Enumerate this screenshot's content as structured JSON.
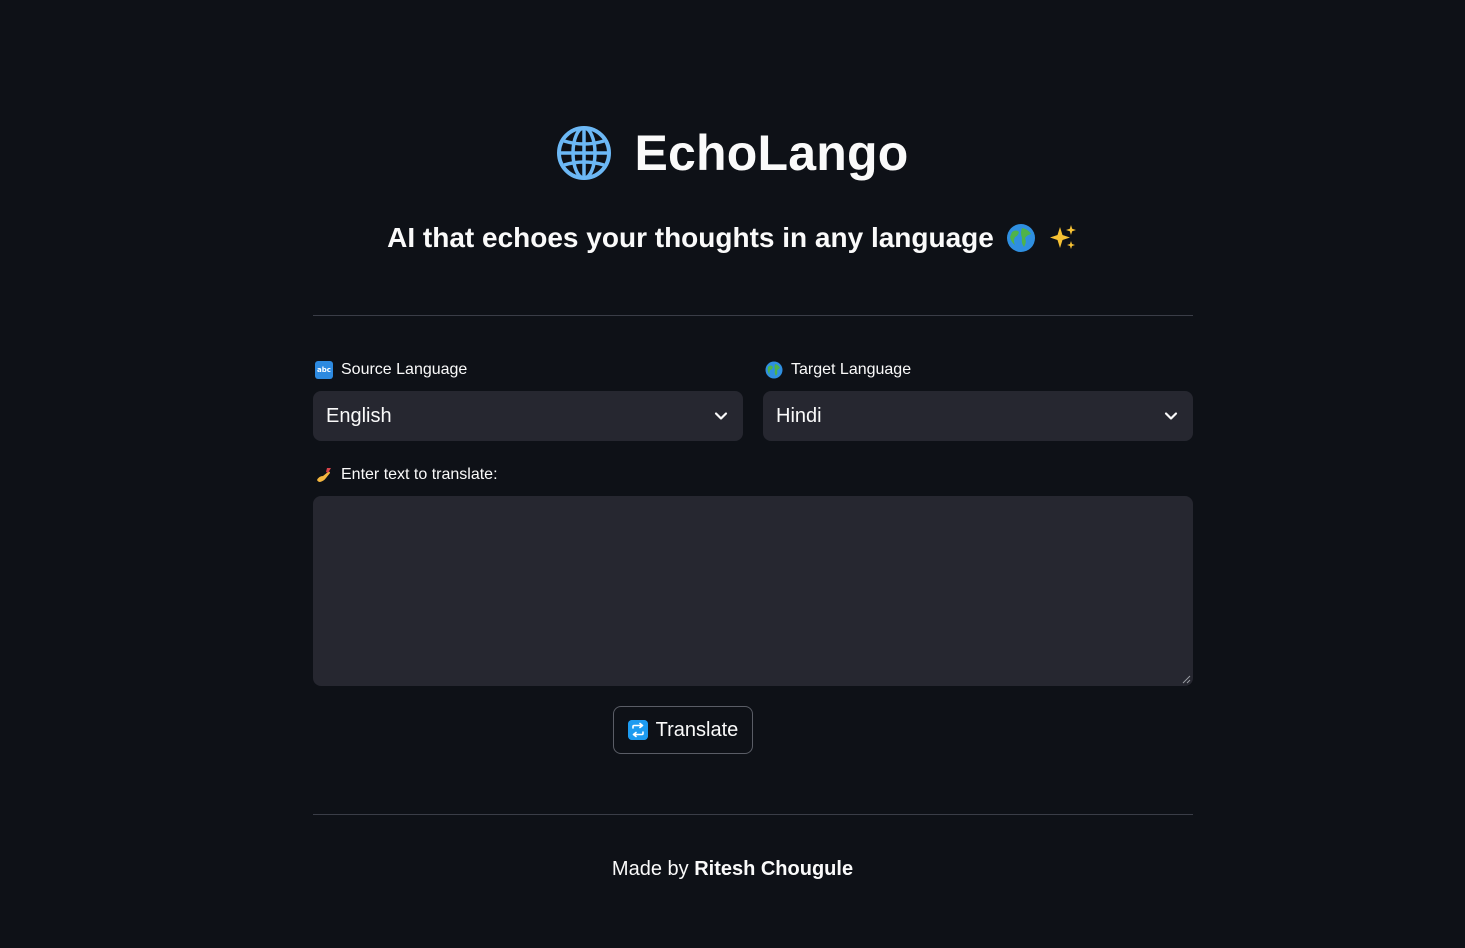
{
  "header": {
    "title": "EchoLango",
    "icon": "globe-with-meridians-icon",
    "subtitle": "AI that echoes your thoughts in any language"
  },
  "source": {
    "label": "Source Language",
    "icon": "abc-icon",
    "value": "English"
  },
  "target": {
    "label": "Target Language",
    "icon": "earth-globe-icon",
    "value": "Hindi"
  },
  "input": {
    "label": "Enter text to translate:",
    "icon": "writing-hand-icon",
    "value": ""
  },
  "button": {
    "label": "Translate",
    "icon": "repeat-icon"
  },
  "footer": {
    "prefix": "Made by",
    "author": "Ritesh Chougule"
  },
  "colors": {
    "background": "#0e1117",
    "surface": "#262730",
    "divider": "#3a3d47",
    "text": "#fafafa",
    "globe_blue": "#6cb8f5"
  }
}
